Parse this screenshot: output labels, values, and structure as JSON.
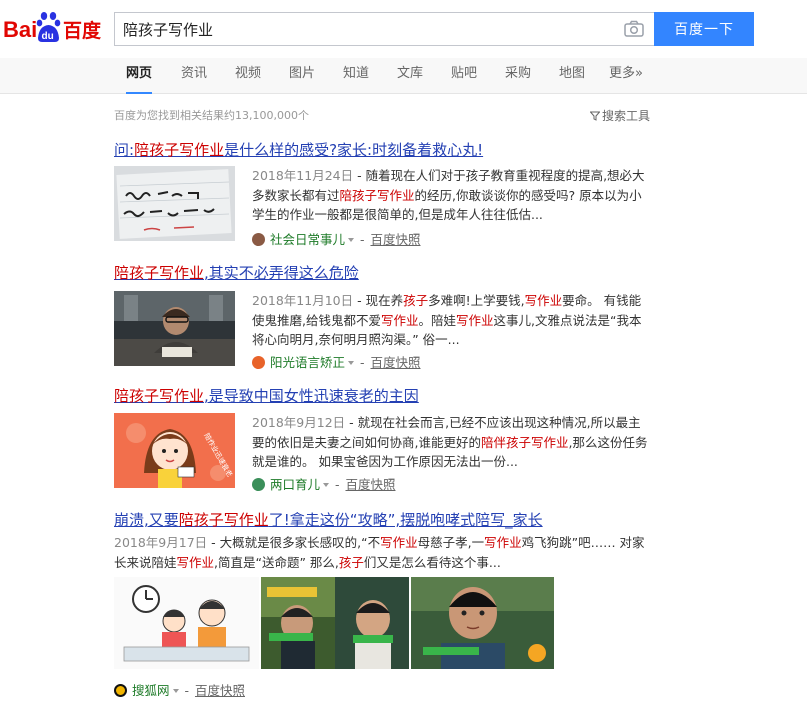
{
  "brand": {
    "logo_letters": "Bai",
    "logo_du": "du",
    "logo_chinese": "百度"
  },
  "search": {
    "query": "陪孩子写作业",
    "button": "百度一下"
  },
  "tabs": [
    "网页",
    "资讯",
    "视频",
    "图片",
    "知道",
    "文库",
    "贴吧",
    "采购",
    "地图",
    "更多»"
  ],
  "stats": {
    "text": "百度为您找到相关结果约13,100,000个",
    "tools": "搜索工具"
  },
  "results": [
    {
      "title": [
        "问:",
        "陪孩子写作业",
        "是什么样的感受?家长:时刻备着救心丸!"
      ],
      "date": "2018年11月24日",
      "abstract": [
        " - 随着现在人们对于孩子教育重视程度的提高,想必大多数家长都有过",
        "陪孩子写作业",
        "的经历,你敢谈谈你的感受吗? 原本以为小学生的作业一般都是很简单的,但是成年人往往低估..."
      ],
      "source": "社会日常事儿",
      "snapshot": "百度快照"
    },
    {
      "title": [
        "",
        "陪孩子写作业",
        ",其实不必弄得这么危险"
      ],
      "date": "2018年11月10日",
      "abstract": [
        " - 现在养",
        "孩子",
        "多难啊!上学要钱,",
        "写作业",
        "要命。 有钱能使鬼推磨,给钱鬼都不爱",
        "写作业",
        "。陪娃",
        "写作业",
        "这事儿,文雅点说法是“我本将心向明月,奈何明月照沟渠。” 俗一..."
      ],
      "source": "阳光语言矫正",
      "snapshot": "百度快照"
    },
    {
      "title": [
        "",
        "陪孩子写作业",
        ",是导致中国女性迅速衰老的主因"
      ],
      "date": "2018年9月12日",
      "abstract": [
        " - 就现在社会而言,已经不应该出现这种情况,所以最主要的依旧是夫妻之间如何协商,谁能更好的",
        "陪伴孩子写作业",
        ",那么这份任务就是谁的。 如果宝爸因为工作原因无法出一份..."
      ],
      "source": "两口育儿",
      "snapshot": "百度快照",
      "thumb_text": "陪作业迅速衰老"
    },
    {
      "title": [
        "崩溃,又要",
        "陪孩子写作业",
        "了!拿走这份“攻略”,摆脱咆哮式陪写_家长"
      ],
      "date": "2018年9月17日",
      "abstract": [
        " - 大概就是很多家长感叹的,“不",
        "写作业",
        "母慈子孝,一",
        "写作业",
        "鸡飞狗跳”吧…… 对家长来说陪娃",
        "写作业",
        ",简直是“送命题” 那么,",
        "孩子",
        "们又是怎么看待这个事..."
      ],
      "source": "搜狐网",
      "snapshot": "百度快照"
    }
  ],
  "colors": {
    "accent": "#3385ff",
    "link": "#2440b3",
    "highlight": "#c00",
    "source": "#1e7b28"
  }
}
